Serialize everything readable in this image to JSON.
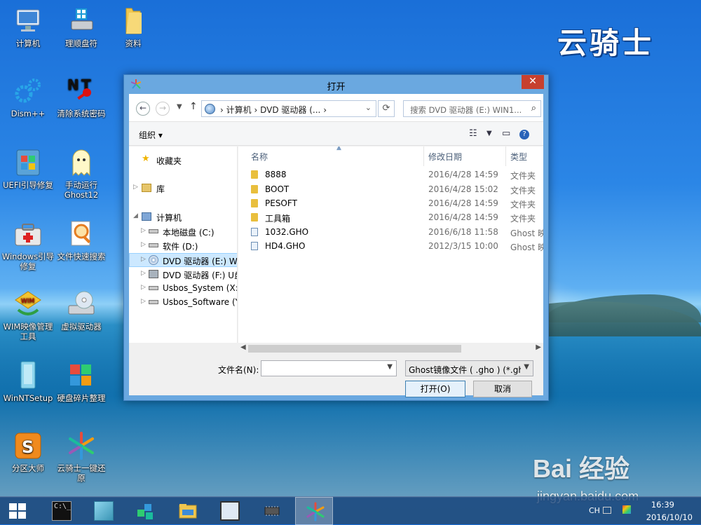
{
  "brand": "云骑士",
  "desktop_icons": [
    {
      "label": "计算机",
      "icon": "computer-icon"
    },
    {
      "label": "理顺盘符",
      "icon": "drive-order-icon"
    },
    {
      "label": "资料",
      "icon": "folder-icon"
    },
    {
      "label": "Dism++",
      "icon": "gears-icon"
    },
    {
      "label": "清除系统密码",
      "icon": "nt-password-icon"
    },
    {
      "label": "UEFI引导修复",
      "icon": "windows-flag-icon"
    },
    {
      "label": "手动运行Ghost12",
      "icon": "ghost-icon"
    },
    {
      "label": "Windows引导修复",
      "icon": "toolbox-icon"
    },
    {
      "label": "文件快速搜索",
      "icon": "magnifier-icon"
    },
    {
      "label": "WIM映像管理工具",
      "icon": "wim-icon"
    },
    {
      "label": "虚拟驱动器",
      "icon": "virtual-drive-icon"
    },
    {
      "label": "WinNTSetup",
      "icon": "winntsetup-icon"
    },
    {
      "label": "硬盘碎片整理",
      "icon": "defrag-icon"
    },
    {
      "label": "分区大师",
      "icon": "partition-icon"
    },
    {
      "label": "云骑士一键还原",
      "icon": "restore-icon"
    }
  ],
  "dialog": {
    "title": "打开",
    "close": "✕",
    "address": {
      "path": [
        "计算机",
        "DVD 驱动器 (..."
      ]
    },
    "search_placeholder": "搜索 DVD 驱动器 (E:) WIN1...",
    "organize": "组织",
    "nav": [
      {
        "label": "收藏夹"
      },
      {
        "label": "库"
      },
      {
        "label": "计算机"
      },
      {
        "label": "本地磁盘 (C:)"
      },
      {
        "label": "软件 (D:)"
      },
      {
        "label": "DVD 驱动器 (E:) WI"
      },
      {
        "label": "DVD 驱动器 (F:) U盘"
      },
      {
        "label": "Usbos_System (X:)"
      },
      {
        "label": "Usbos_Software (Y"
      }
    ],
    "columns": {
      "name": "名称",
      "date": "修改日期",
      "type": "类型"
    },
    "files": [
      {
        "name": "8888",
        "date": "2016/4/28 14:59",
        "type": "文件夹",
        "kind": "folder"
      },
      {
        "name": "BOOT",
        "date": "2016/4/28 15:02",
        "type": "文件夹",
        "kind": "folder"
      },
      {
        "name": "PESOFT",
        "date": "2016/4/28 14:59",
        "type": "文件夹",
        "kind": "folder"
      },
      {
        "name": "工具箱",
        "date": "2016/4/28 14:59",
        "type": "文件夹",
        "kind": "folder"
      },
      {
        "name": "1032.GHO",
        "date": "2016/6/18 11:58",
        "type": "Ghost 映",
        "kind": "file"
      },
      {
        "name": "HD4.GHO",
        "date": "2012/3/15 10:00",
        "type": "Ghost 映",
        "kind": "file"
      }
    ],
    "filename_label": "文件名(N):",
    "filename_value": "",
    "filter": "Ghost镜像文件 ( .gho ) (*.gh",
    "open_button": "打开(O)",
    "cancel_button": "取消"
  },
  "watermark": {
    "logo": "Bai 经验",
    "site": "jingyan.baidu.com"
  },
  "tray": {
    "lang": "CH",
    "time": "16:39",
    "date": "2016/10/10"
  }
}
